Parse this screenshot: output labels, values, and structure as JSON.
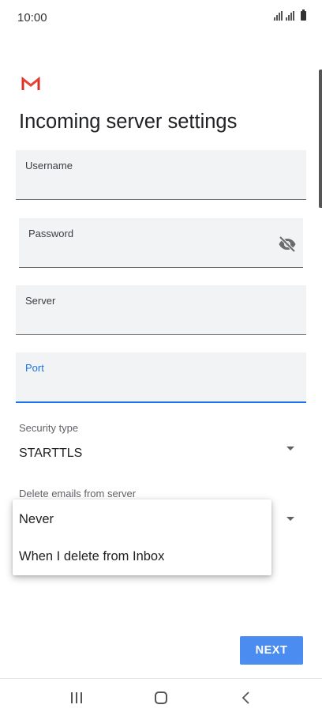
{
  "status_bar": {
    "time": "10:00"
  },
  "page": {
    "title": "Incoming server settings"
  },
  "form": {
    "username_label": "Username",
    "password_label": "Password",
    "server_label": "Server",
    "port_label": "Port",
    "security_type_label": "Security type",
    "security_type_value": "STARTTLS",
    "delete_emails_label": "Delete emails from server"
  },
  "dropdown": {
    "options": [
      "Never",
      "When I delete from Inbox"
    ]
  },
  "actions": {
    "next_label": "NEXT"
  },
  "colors": {
    "accent": "#1a73e8",
    "button": "#4a8cf0",
    "field_bg": "#f1f3f4",
    "gmail_red": "#d93025"
  },
  "icons": [
    "gmail-logo-icon",
    "visibility-off-icon",
    "dropdown-arrow-icon",
    "recent-apps-icon",
    "home-icon",
    "back-icon"
  ]
}
